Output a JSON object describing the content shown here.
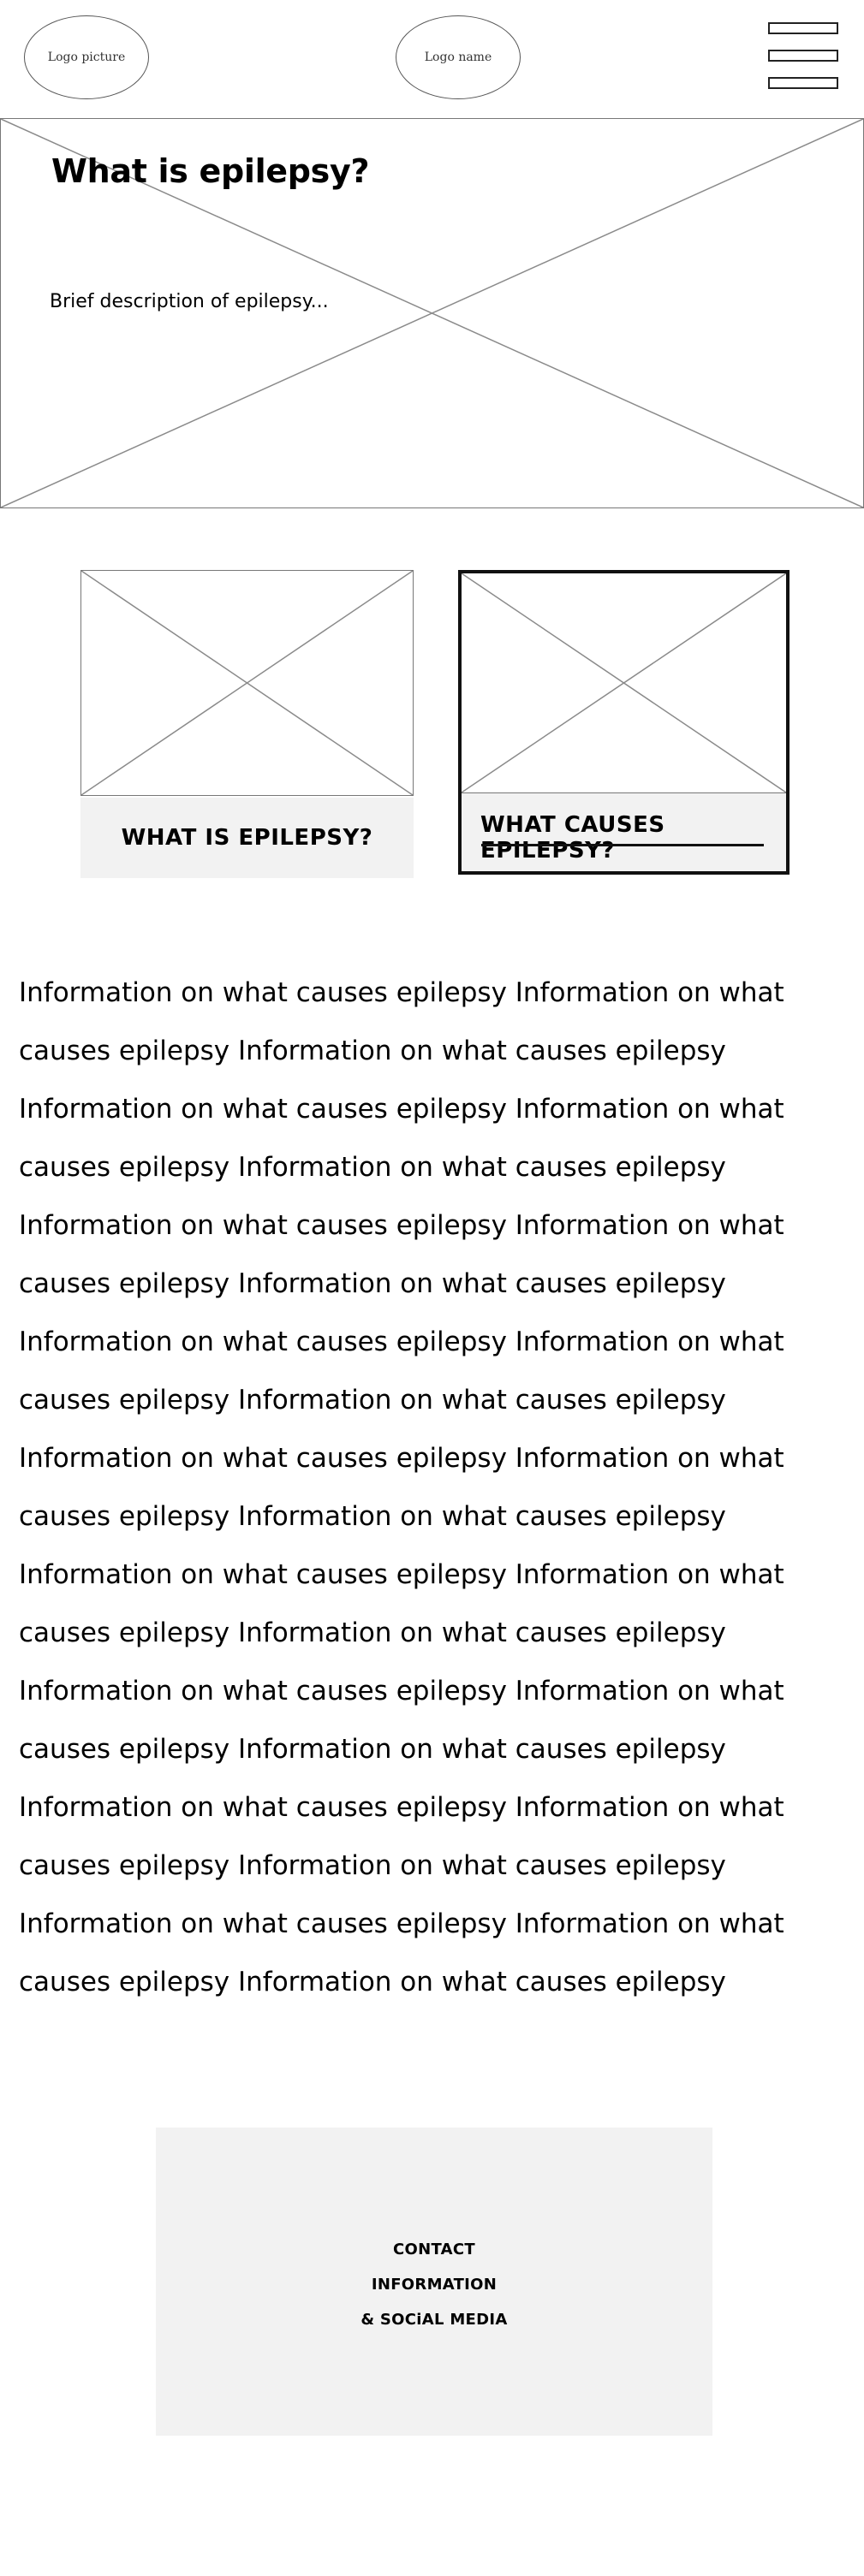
{
  "header": {
    "logo_picture_label": "Logo picture",
    "logo_name_label": "Logo name",
    "menu_icon": "hamburger-menu-icon"
  },
  "hero": {
    "title": "What is epilepsy?",
    "description": "Brief description of epilepsy..."
  },
  "cards": [
    {
      "label": "WHAT IS EPILEPSY?",
      "active": false
    },
    {
      "label": "WHAT CAUSES EPILEPSY?",
      "active": true
    }
  ],
  "info": {
    "paragraphs": [
      "Information on what causes epilepsy Information on what causes epilepsy Information on what causes epilepsy",
      "Information on what causes epilepsy Information on what causes epilepsy Information on what causes epilepsy",
      "Information on what causes epilepsy Information on what causes epilepsy Information on what causes epilepsy",
      "Information on what causes epilepsy Information on what causes epilepsy Information on what causes epilepsy",
      "Information on what causes epilepsy Information on what causes epilepsy Information on what causes epilepsy",
      "Information on what causes epilepsy Information on what causes epilepsy Information on what causes epilepsy",
      "Information on what causes epilepsy Information on what causes epilepsy Information on what causes epilepsy",
      "Information on what causes epilepsy Information on what causes epilepsy Information on what causes epilepsy",
      "Information on what causes epilepsy Information on what causes epilepsy Information on what causes epilepsy"
    ]
  },
  "footer": {
    "line1": "CONTACT",
    "line2": "INFORMATION",
    "line3": "& SOCiAL MEDIA"
  },
  "colors": {
    "placeholder_fill": "#f2f2f2",
    "outline": "#777777",
    "active_border": "#111111"
  }
}
